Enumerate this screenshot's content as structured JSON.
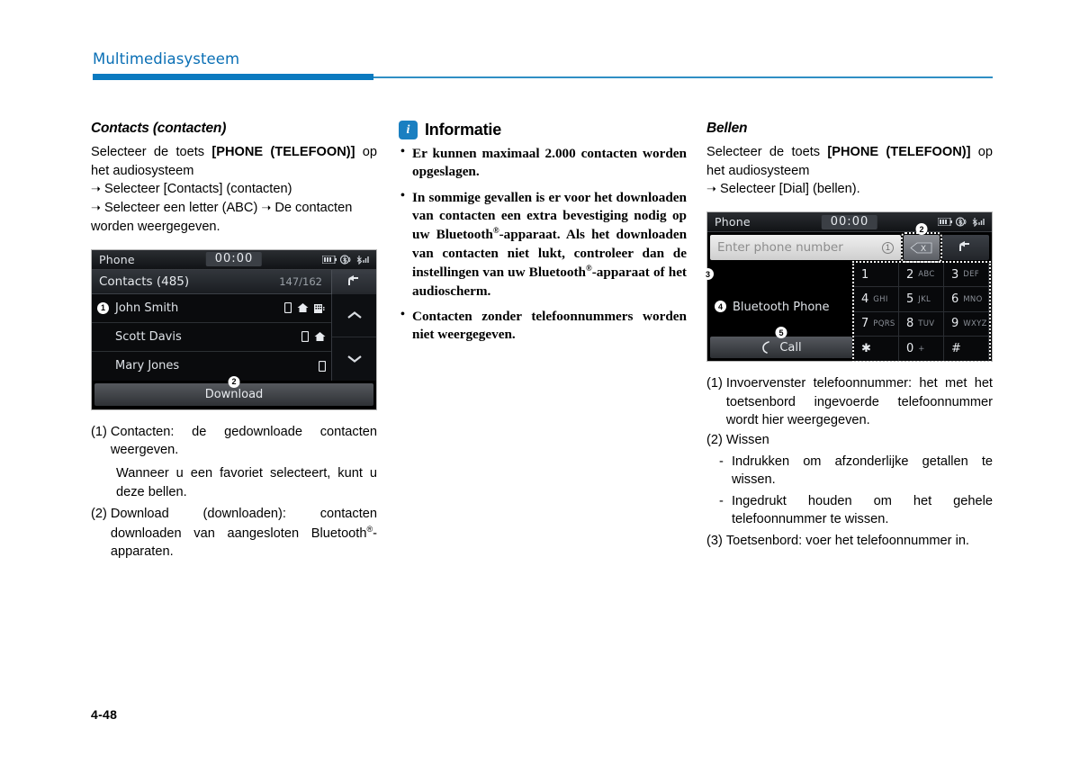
{
  "header": {
    "title": "Multimediasysteem",
    "accent": "#0b7ac0"
  },
  "footer": {
    "page": "4-48"
  },
  "col1": {
    "heading": "Contacts (contacten)",
    "intro_1": "Selecteer de toets ",
    "intro_bold_1": "[PHONE (TELEFOON)]",
    "intro_2": " op het audiosysteem",
    "intro_3": "Selecteer [Contacts] (contacten)",
    "intro_4": "Selecteer een letter (ABC)",
    "intro_5": "De contacten worden weergegeven.",
    "screen": {
      "device_name": "Phone",
      "clock": "00:00",
      "list_title": "Contacts (485)",
      "count": "147/162",
      "rows": [
        {
          "name": "John Smith",
          "icons": [
            "mobile-icon",
            "home-icon",
            "office-icon"
          ],
          "marker": "1"
        },
        {
          "name": "Scott Davis",
          "icons": [
            "mobile-icon",
            "home-icon"
          ],
          "marker": ""
        },
        {
          "name": "Mary Jones",
          "icons": [
            "mobile-icon"
          ],
          "marker": ""
        }
      ],
      "download_label": "Download",
      "download_marker": "2"
    },
    "desc": [
      {
        "num": "(1)",
        "text": "Contacten: de gedownloade contacten weergeven."
      },
      {
        "plain": "Wanneer u een favoriet selecteert, kunt u deze bellen."
      },
      {
        "num": "(2)",
        "text_a": "Download (downloaden): contacten downloaden van aangesloten Bluetooth",
        "reg": "®",
        "text_b": "-apparaten."
      }
    ]
  },
  "col2": {
    "info_icon": "i",
    "info_title": "Informatie",
    "bullets": [
      {
        "text": "Er kunnen maximaal 2.000 contacten worden opgeslagen."
      },
      {
        "pre": "In sommige gevallen is er voor het downloaden van contacten een extra bevestiging nodig op uw Bluetooth",
        "reg1": "®",
        "mid": "-apparaat. Als het downloaden van contacten niet lukt, controleer dan de instellingen van uw Bluetooth",
        "reg2": "®",
        "post": "-apparaat of het audioscherm."
      },
      {
        "text": "Contacten zonder telefoonnummers worden niet weergegeven."
      }
    ]
  },
  "col3": {
    "heading": "Bellen",
    "intro_1": "Selecteer de toets ",
    "intro_bold_1": "[PHONE (TELEFOON)]",
    "intro_2": " op het audiosysteem",
    "intro_3": "Selecteer [Dial] (bellen).",
    "screen": {
      "device_name": "Phone",
      "clock": "00:00",
      "input_placeholder": "Enter phone number",
      "input_value": "",
      "input_marker": "1",
      "clear_label": "X",
      "clear_marker": "2",
      "keypad_marker": "3",
      "bluetooth_label": "Bluetooth Phone",
      "bluetooth_marker": "4",
      "call_label": "Call",
      "call_marker": "5",
      "keys": [
        {
          "num": "1",
          "ltr": ""
        },
        {
          "num": "2",
          "ltr": "ABC"
        },
        {
          "num": "3",
          "ltr": "DEF"
        },
        {
          "num": "4",
          "ltr": "GHI"
        },
        {
          "num": "5",
          "ltr": "JKL"
        },
        {
          "num": "6",
          "ltr": "MNO"
        },
        {
          "num": "7",
          "ltr": "PQRS"
        },
        {
          "num": "8",
          "ltr": "TUV"
        },
        {
          "num": "9",
          "ltr": "WXYZ"
        },
        {
          "num": "✱",
          "ltr": ""
        },
        {
          "num": "0",
          "ltr": "+"
        },
        {
          "num": "#",
          "ltr": ""
        }
      ]
    },
    "desc": [
      {
        "num": "(1)",
        "text": "Invoervenster telefoonnummer: het met het toetsenbord ingevoerde telefoonnummer wordt hier weergegeven."
      },
      {
        "num": "(2)",
        "text": "Wissen"
      },
      {
        "dash": "-",
        "text": "Indrukken om afzonderlijke getallen te wissen."
      },
      {
        "dash2": "-",
        "text2": "Ingedrukt houden om het gehele telefoonnummer te wissen."
      },
      {
        "num": "(3)",
        "text": "Toetsenbord: voer het telefoonnummer in."
      }
    ]
  }
}
